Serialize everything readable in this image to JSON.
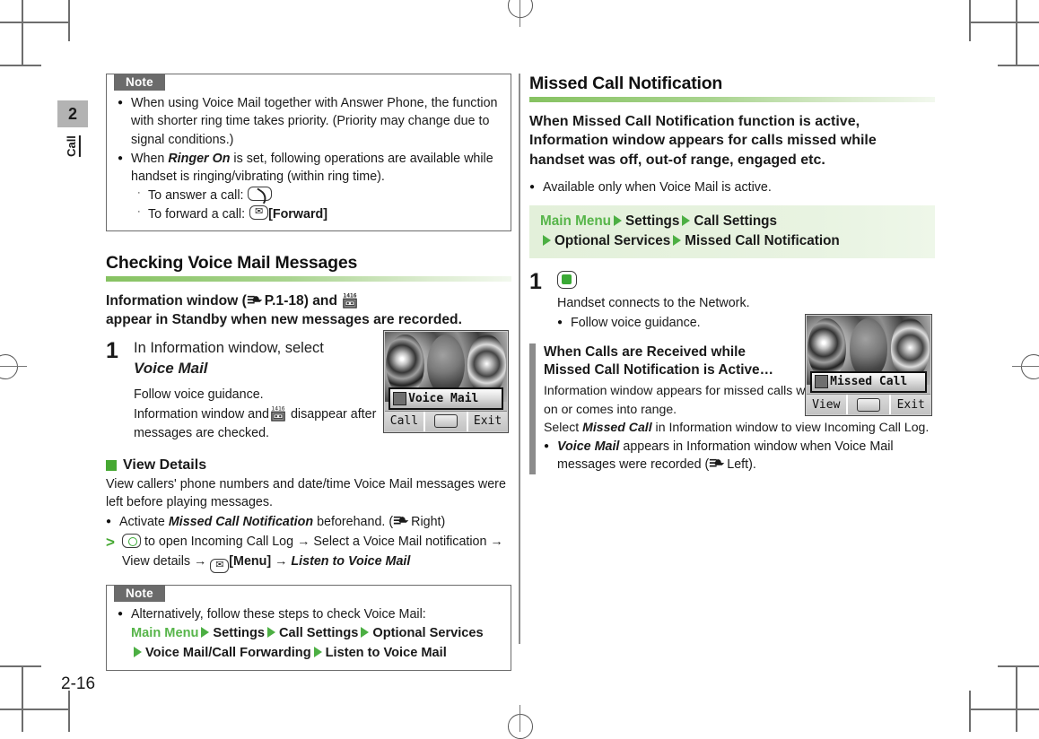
{
  "page": {
    "number": "2-16",
    "chapter_number": "2",
    "chapter_label": "Call"
  },
  "left_column": {
    "note_top": {
      "tab_label": "Note",
      "items": [
        {
          "text_parts": [
            {
              "t": "When using Voice Mail together with Answer Phone, the function with shorter ring time takes priority. (Priority may change due to signal conditions.)",
              "style": "normal"
            }
          ]
        },
        {
          "text_parts": [
            {
              "t": "When ",
              "style": "normal"
            },
            {
              "t": "Ringer On",
              "style": "bold-italic"
            },
            {
              "t": " is set, following operations are available while handset is ringing/vibrating (within ring time).",
              "style": "normal"
            }
          ]
        }
      ],
      "sub_items": [
        {
          "label": "To answer a call:",
          "icon": "call-key-icon",
          "trailing": ""
        },
        {
          "label": "To forward a call:",
          "icon": "mail-key-icon",
          "trailing": "[Forward]"
        }
      ]
    },
    "section": {
      "heading": "Checking Voice Mail Messages",
      "lead_line1_a": "Information window (",
      "lead_line1_ref": "P.1-18",
      "lead_line1_b": ") and",
      "lead_line2": "appear in Standby when new messages are recorded.",
      "step": {
        "number": "1",
        "title_line1": "In Information window, select",
        "title_line2": "Voice Mail",
        "sub_line1": "Follow voice guidance.",
        "sub_line2_a": "Information window and",
        "sub_line2_b": "disappear after",
        "sub_line3": "messages are checked."
      }
    },
    "view_details": {
      "heading": "View Details",
      "para": "View callers' phone numbers and date/time Voice Mail messages were left before playing messages.",
      "bullet_a": "Activate ",
      "bullet_b": "Missed Call Notification",
      "bullet_c": " beforehand. (",
      "bullet_ref": "Right",
      "bullet_d": ")",
      "op_line1_a": " to open Incoming Call Log ",
      "op_line1_arrow1": "→",
      "op_line1_b": " Select a Voice Mail notification ",
      "op_line1_arrow2": "→",
      "op_line2_a": "View details ",
      "op_line2_arrow1": "→",
      "op_line2_menu": "[Menu]",
      "op_line2_arrow2": "→",
      "op_line2_target": "Listen to Voice Mail"
    },
    "note_bottom": {
      "tab_label": "Note",
      "bullet": "Alternatively, follow these steps to check Voice Mail:",
      "menu_path": {
        "root": "Main Menu",
        "steps_line1": [
          "Settings",
          "Call Settings",
          "Optional Services"
        ],
        "steps_line2": [
          "Voice Mail/Call Forwarding",
          "Listen to Voice Mail"
        ]
      }
    }
  },
  "right_column": {
    "section": {
      "heading": "Missed Call Notification",
      "lead": "When Missed Call Notification function is active, Information window appears for calls missed while handset was off, out-of range, engaged etc.",
      "bullet": "Available only when Voice Mail is active.",
      "menu_band": {
        "root": "Main Menu",
        "steps_line1": [
          "Settings",
          "Call Settings"
        ],
        "steps_line2": [
          "Optional Services",
          "Missed Call Notification"
        ]
      },
      "step": {
        "number": "1",
        "key_icon": "center-key-icon",
        "sub_line1": "Handset connects to the Network.",
        "sub_bullet": "Follow voice guidance."
      }
    },
    "callout": {
      "title_line1": "When Calls are Received while",
      "title_line2": "Missed Call Notification is Active…",
      "para1": "Information window appears for missed calls when handset is turned on or comes into range.",
      "para2_a": "Select ",
      "para2_b": "Missed Call",
      "para2_c": " in Information window to view Incoming Call Log.",
      "bullet_a": "Voice Mail",
      "bullet_b": " appears in Information window when Voice Mail messages were recorded (",
      "bullet_ref": "Left",
      "bullet_c": ")."
    }
  },
  "phone_left": {
    "info_window_label": "Voice Mail",
    "info_window_icon": "answerphone-icon",
    "softkeys": [
      "Call",
      "",
      "Exit"
    ],
    "center_softkey_icon": "center-select-icon"
  },
  "phone_right": {
    "info_window_label": "Missed Call",
    "info_window_icon": "missed-call-icon",
    "softkeys": [
      "View",
      "",
      "Exit"
    ],
    "center_softkey_icon": "center-select-icon"
  },
  "colors": {
    "accent_green": "#46a832",
    "menu_root_green": "#57b54a",
    "note_tab_gray": "#6b6b6b",
    "callout_bar_gray": "#8c8c8c",
    "chapter_tab_gray": "#b3b3b3"
  }
}
